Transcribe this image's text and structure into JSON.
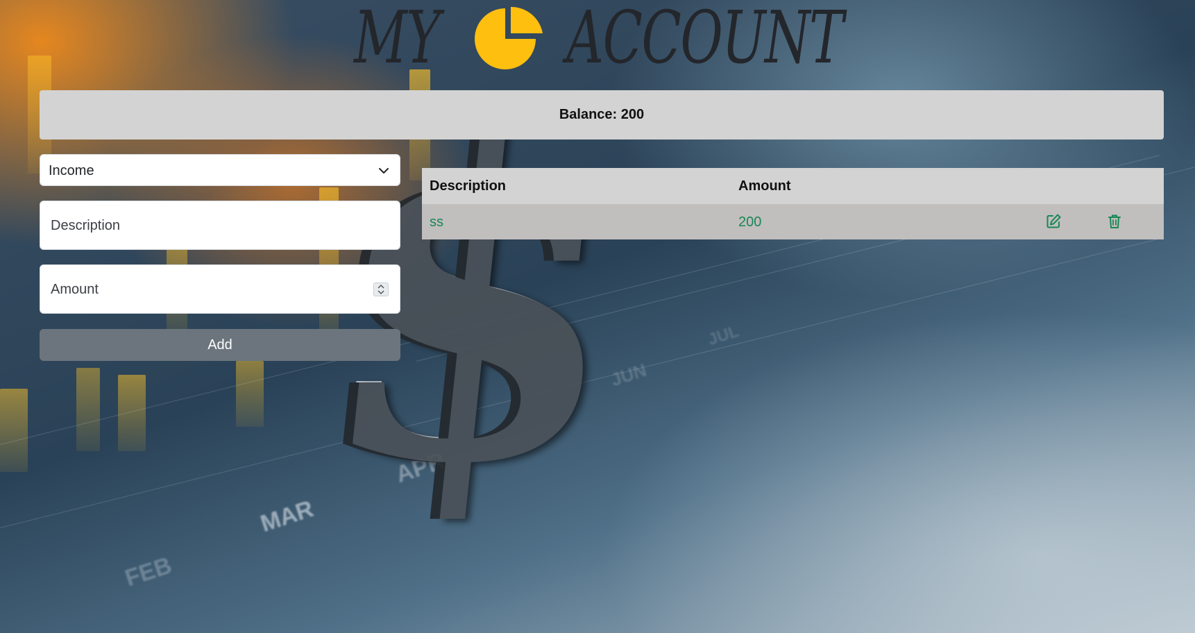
{
  "header": {
    "title_left": "MY",
    "title_right": "ACCOUNT",
    "logo_icon": "pie-chart-icon",
    "logo_color": "#ffbf0f"
  },
  "balance": {
    "label": "Balance:",
    "value": "200"
  },
  "form": {
    "type_select": {
      "value": "Income",
      "icon": "chevron-down-icon"
    },
    "description_input": {
      "placeholder": "Description"
    },
    "amount_input": {
      "placeholder": "Amount",
      "icon": "number-spinner-icon"
    },
    "add_button": {
      "label": "Add",
      "color": "#6c757d"
    }
  },
  "table": {
    "columns": [
      "Description",
      "Amount"
    ],
    "rows": [
      {
        "description": "ss",
        "amount": "200",
        "edit_icon": "edit-icon",
        "delete_icon": "trash-icon"
      }
    ],
    "row_text_color": "#198754"
  },
  "background": {
    "month_labels": [
      "MAR",
      "FEB",
      "APR",
      "JUN",
      "JUL"
    ],
    "icon": "dollar-sign-icon"
  }
}
